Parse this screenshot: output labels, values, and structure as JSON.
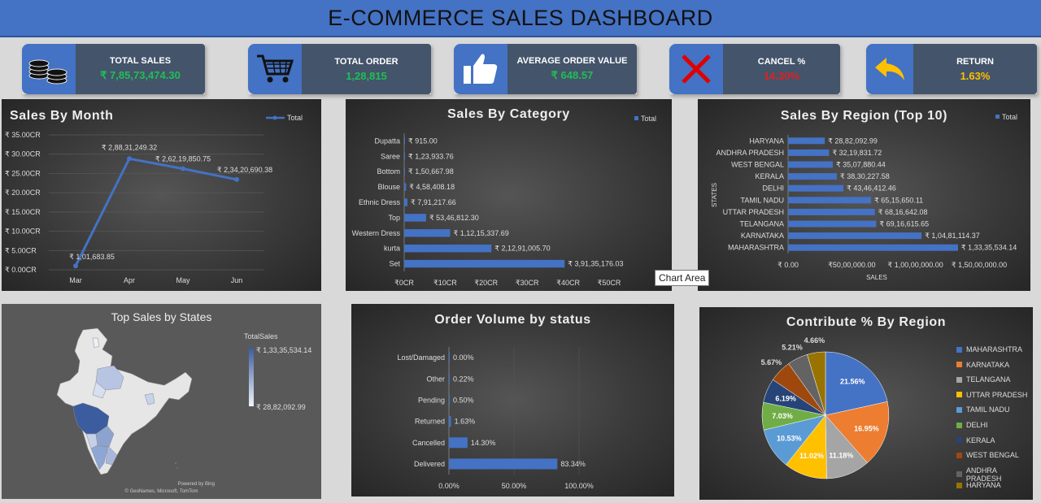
{
  "title": "E-COMMERCE SALES DASHBOARD",
  "kpis": [
    {
      "label": "TOTAL SALES",
      "value": "₹ 7,85,73,474.30",
      "color": "#1fbf55",
      "icon": "coins-icon"
    },
    {
      "label": "TOTAL ORDER",
      "value": "1,28,815",
      "color": "#1fbf55",
      "icon": "cart-icon"
    },
    {
      "label": "AVERAGE ORDER VALUE",
      "value": "₹ 648.57",
      "color": "#1fbf55",
      "icon": "thumbs-up-icon"
    },
    {
      "label": "CANCEL %",
      "value": "14.30%",
      "color": "#e02020",
      "icon": "cross-icon"
    },
    {
      "label": "RETURN",
      "value": "1.63%",
      "color": "#ffc000",
      "icon": "return-arrow-icon"
    }
  ],
  "tooltip": "Chart Area",
  "chart_data": [
    {
      "id": "month",
      "type": "line",
      "title": "Sales By Month",
      "legend": "Total",
      "legend_position": "top-right",
      "categories": [
        "Mar",
        "Apr",
        "May",
        "Jun"
      ],
      "values": [
        1011683.85,
        28831249.32,
        26219850.75,
        23420690.38
      ],
      "data_labels": [
        "₹ 1,01,683.85",
        "₹ 2,88,31,249.32",
        "₹ 2,62,19,850.75",
        "₹ 2,34,20,690.38"
      ],
      "y_ticks": [
        "₹ 0.00CR",
        "₹ 5.00CR",
        "₹ 10.00CR",
        "₹ 15.00CR",
        "₹ 20.00CR",
        "₹ 25.00CR",
        "₹ 30.00CR",
        "₹ 35.00CR"
      ],
      "ylim": [
        0,
        35000000
      ],
      "color": "#4472c4"
    },
    {
      "id": "category",
      "type": "bar",
      "orientation": "horizontal",
      "title": "Sales By Category",
      "legend": "Total",
      "legend_position": "top-right",
      "categories": [
        "Dupatta",
        "Saree",
        "Bottom",
        "Blouse",
        "Ethnic Dress",
        "Top",
        "Western Dress",
        "kurta",
        "Set"
      ],
      "values": [
        915.0,
        123933.76,
        150667.98,
        458408.18,
        791217.66,
        5346812.3,
        11215337.69,
        21291005.7,
        39135176.03
      ],
      "data_labels": [
        "₹ 915.00",
        "₹ 1,23,933.76",
        "₹ 1,50,667.98",
        "₹ 4,58,408.18",
        "₹ 7,91,217.66",
        "₹ 53,46,812.30",
        "₹ 1,12,15,337.69",
        "₹ 2,12,91,005.70",
        "₹ 3,91,35,176.03"
      ],
      "x_ticks": [
        "₹0CR",
        "₹10CR",
        "₹20CR",
        "₹30CR",
        "₹40CR",
        "₹50CR"
      ],
      "xlim": [
        0,
        50000000
      ],
      "color": "#4472c4"
    },
    {
      "id": "region",
      "type": "bar",
      "orientation": "horizontal",
      "title": "Sales By Region (Top 10)",
      "legend": "Total",
      "legend_position": "top-right",
      "xlabel": "SALES",
      "ylabel": "STATES",
      "categories": [
        "HARYANA",
        "ANDHRA PRADESH",
        "WEST BENGAL",
        "KERALA",
        "DELHI",
        "TAMIL NADU",
        "UTTAR PRADESH",
        "TELANGANA",
        "KARNATAKA",
        "MAHARASHTRA"
      ],
      "values": [
        2882092.99,
        3219831.72,
        3507880.44,
        3830227.58,
        4346412.46,
        6515650.11,
        6816642.08,
        6916615.65,
        10481114.37,
        13335534.14
      ],
      "data_labels": [
        "₹ 28,82,092.99",
        "₹ 32,19,831.72",
        "₹ 35,07,880.44",
        "₹ 38,30,227.58",
        "₹ 43,46,412.46",
        "₹ 65,15,650.11",
        "₹ 68,16,642.08",
        "₹ 69,16,615.65",
        "₹ 1,04,81,114.37",
        "₹ 1,33,35,534.14"
      ],
      "x_ticks": [
        "₹ 0.00",
        "₹50,00,000.00",
        "₹ 1,00,00,000.00",
        "₹ 1,50,00,000.00"
      ],
      "xlim": [
        0,
        15000000
      ],
      "color": "#4472c4"
    },
    {
      "id": "status",
      "type": "bar",
      "orientation": "horizontal",
      "title": "Order Volume by status",
      "categories": [
        "Lost/Damaged",
        "Other",
        "Pending",
        "Returned",
        "Cancelled",
        "Delivered"
      ],
      "values": [
        0.0,
        0.22,
        0.5,
        1.63,
        14.3,
        83.34
      ],
      "data_labels": [
        "0.00%",
        "0.22%",
        "0.50%",
        "1.63%",
        "14.30%",
        "83.34%"
      ],
      "x_ticks": [
        "0.00%",
        "50.00%",
        "100.00%"
      ],
      "xlim": [
        0,
        100
      ],
      "color": "#4472c4"
    },
    {
      "id": "contribution",
      "type": "pie",
      "title": "Contribute % By Region",
      "legend_position": "right",
      "slices": [
        {
          "name": "MAHARASHTRA",
          "value": 21.56,
          "label": "21.56%",
          "color": "#4472c4"
        },
        {
          "name": "KARNATAKA",
          "value": 16.95,
          "label": "16.95%",
          "color": "#ed7d31"
        },
        {
          "name": "TELANGANA",
          "value": 11.18,
          "label": "11.18%",
          "color": "#a5a5a5"
        },
        {
          "name": "UTTAR PRADESH",
          "value": 11.02,
          "label": "11.02%",
          "color": "#ffc000"
        },
        {
          "name": "TAMIL NADU",
          "value": 10.53,
          "label": "10.53%",
          "color": "#5b9bd5"
        },
        {
          "name": "DELHI",
          "value": 7.03,
          "label": "7.03%",
          "color": "#70ad47"
        },
        {
          "name": "KERALA",
          "value": 6.19,
          "label": "6.19%",
          "color": "#264478"
        },
        {
          "name": "WEST BENGAL",
          "value": 5.67,
          "label": "5.67%",
          "color": "#9e480e"
        },
        {
          "name": "ANDHRA PRADESH",
          "value": 5.21,
          "label": "5.21%",
          "color": "#636363"
        },
        {
          "name": "HARYANA",
          "value": 4.66,
          "label": "4.66%",
          "color": "#997300"
        }
      ]
    }
  ],
  "map": {
    "title": "Top Sales by States",
    "legend_title": "TotalSales",
    "legend_max": "₹ 1,33,35,534.14",
    "legend_min": "₹ 28,82,092.99",
    "credit_1": "Powered by Bing",
    "credit_2": "© GeoNames, Microsoft, TomTom"
  }
}
